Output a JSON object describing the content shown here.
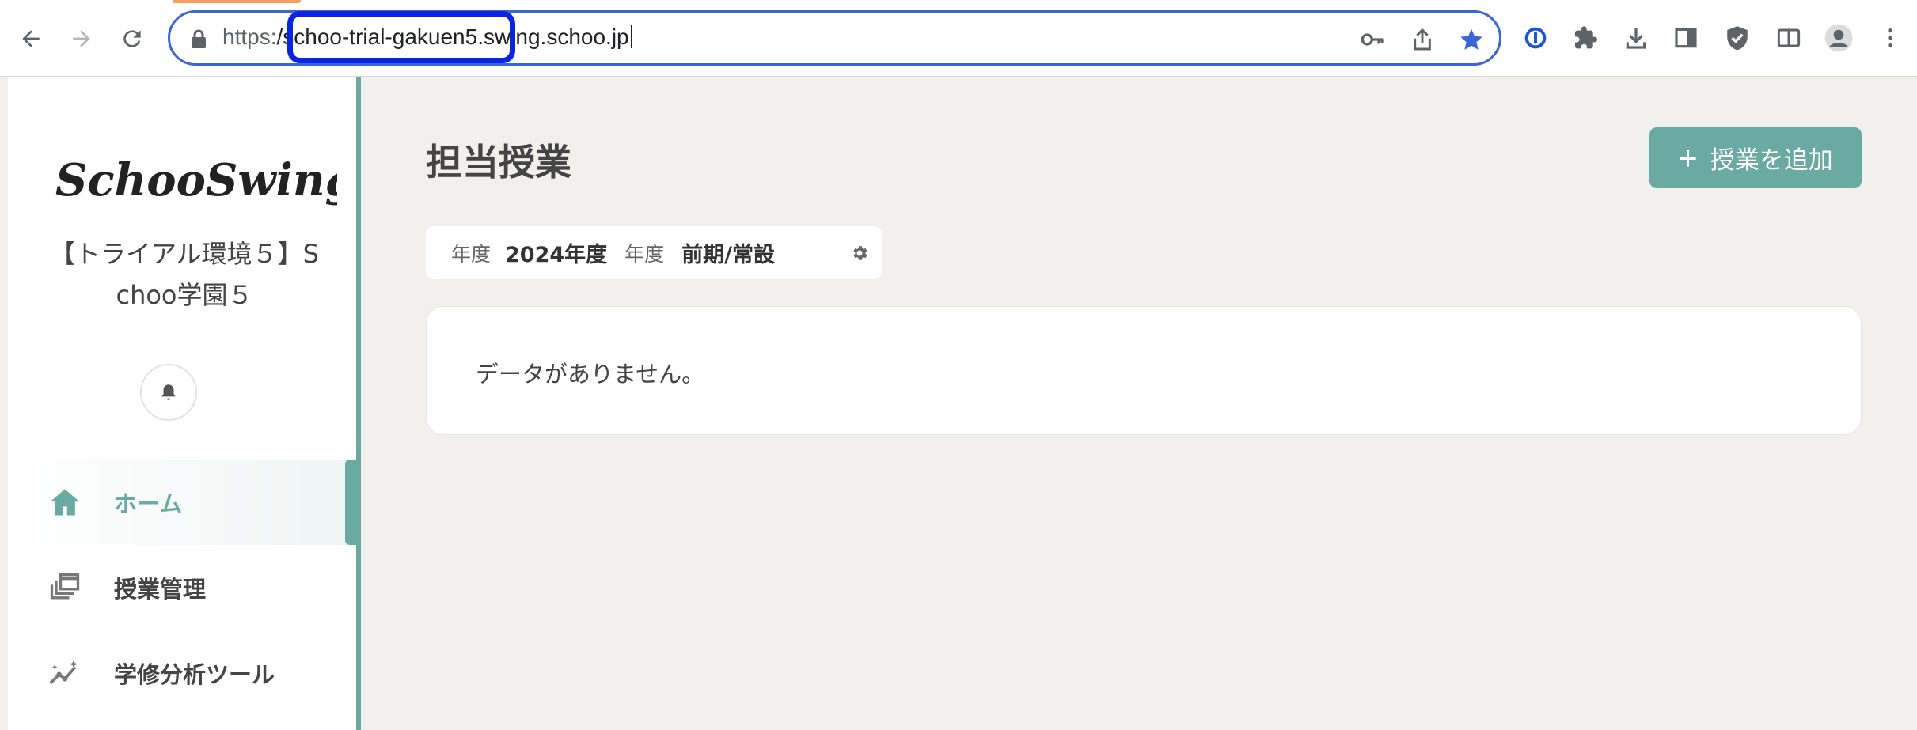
{
  "browser": {
    "url_scheme": "https:",
    "url_highlighted": "/schoo-trial-gakuen5",
    "url_rest": ".swing.schoo.jp",
    "icons": [
      "back-arrow-icon",
      "forward-arrow-icon",
      "reload-icon",
      "lock-icon",
      "key-icon",
      "share-icon",
      "star-icon",
      "password-manager-icon",
      "extensions-icon",
      "download-icon",
      "sidepanel-icon",
      "shield-icon",
      "split-view-icon",
      "profile-icon",
      "more-menu-icon"
    ],
    "highlight_color": "#0a24e0",
    "accent": "#3a66d8"
  },
  "sidebar": {
    "logo_text": "SchooSwing",
    "school_line1": "【トライアル環境５】S",
    "school_line2": "choo学園５",
    "nav": [
      {
        "label": "ホーム",
        "icon": "home-icon",
        "active": true
      },
      {
        "label": "授業管理",
        "icon": "classes-icon",
        "active": false
      },
      {
        "label": "学修分析ツール",
        "icon": "analytics-icon",
        "active": false
      }
    ]
  },
  "main": {
    "title": "担当授業",
    "add_button": "授業を追加",
    "filter": {
      "year_label": "年度",
      "year_value": "2024年度",
      "term_label": "年度",
      "term_value": "前期/常設"
    },
    "empty_message": "データがありません。"
  },
  "colors": {
    "brand_teal": "#6aaaa2",
    "background": "#f2f0ed"
  }
}
